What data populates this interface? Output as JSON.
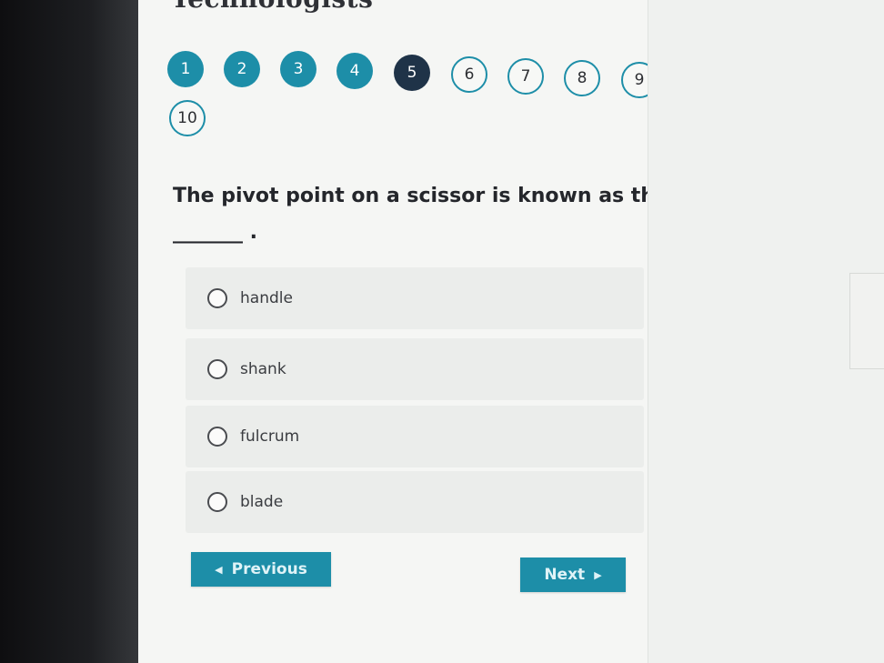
{
  "header": {
    "site_title": "Technologists"
  },
  "question_nav": [
    {
      "label": "1",
      "state": "answered"
    },
    {
      "label": "2",
      "state": "answered"
    },
    {
      "label": "3",
      "state": "answered"
    },
    {
      "label": "4",
      "state": "answered"
    },
    {
      "label": "5",
      "state": "current"
    },
    {
      "label": "6",
      "state": "unanswered"
    },
    {
      "label": "7",
      "state": "unanswered"
    },
    {
      "label": "8",
      "state": "unanswered"
    },
    {
      "label": "9",
      "state": "unanswered"
    },
    {
      "label": "10",
      "state": "unanswered"
    }
  ],
  "question": {
    "line1": "The pivot point on a scissor is known as the",
    "line2": "_______ ."
  },
  "options": [
    {
      "label": "handle",
      "selected": false
    },
    {
      "label": "shank",
      "selected": false
    },
    {
      "label": "fulcrum",
      "selected": false
    },
    {
      "label": "blade",
      "selected": false
    }
  ],
  "buttons": {
    "previous_label": "Previous",
    "next_label": "Next",
    "previous_icon": "caret-left-icon",
    "next_icon": "caret-right-icon"
  },
  "colors": {
    "accent": "#1d8ea8",
    "current": "#1f3348"
  }
}
